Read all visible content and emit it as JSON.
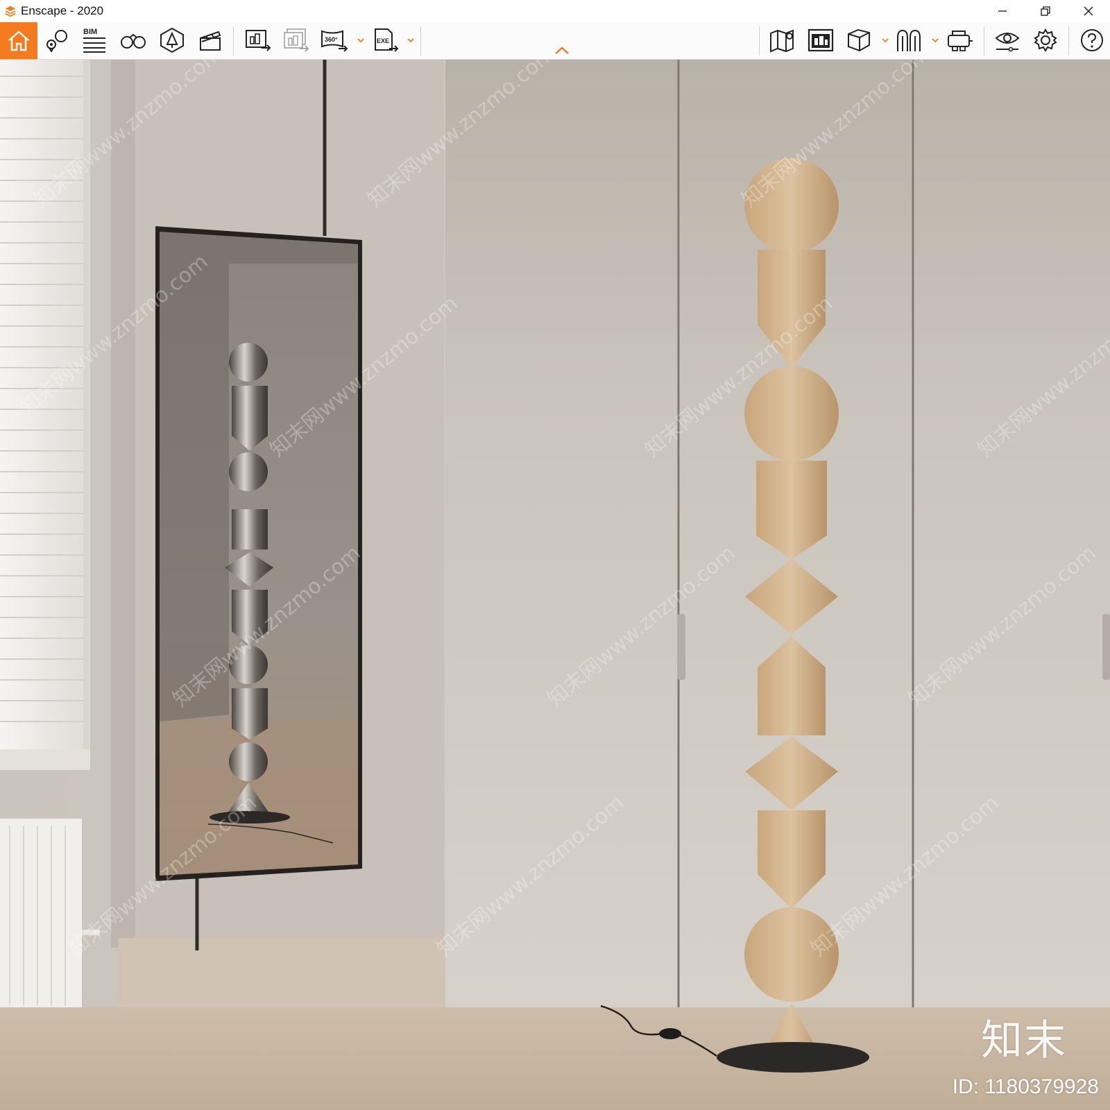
{
  "window": {
    "title": "Enscape - 2020",
    "controls": [
      "minimize-icon",
      "restore-icon",
      "close-icon"
    ]
  },
  "toolbar": {
    "accent_color": "#f47b20",
    "bim_label": "BIM",
    "left_tools": [
      "home-icon",
      "pin-tag-icon",
      "bim-list-icon",
      "binoculars-icon",
      "light-view-icon",
      "clapperboard-icon"
    ],
    "export_tools": [
      "screenshot-export-icon",
      "batch-export-icon",
      "panorama-360-icon",
      "exe-export-icon"
    ],
    "right_tools": [
      "map-pin-icon",
      "asset-library-icon",
      "cube-view-icon",
      "audio-icon",
      "vr-headset-icon",
      "visual-settings-icon",
      "gear-icon",
      "help-icon"
    ],
    "panorama_label": "360°",
    "exe_label": "EXE"
  },
  "viewport": {
    "scene": "render-view",
    "watermark_logo": "知末",
    "watermark_id": "ID: 1180379928",
    "watermark_text": "知末网www.znzmo.com"
  }
}
